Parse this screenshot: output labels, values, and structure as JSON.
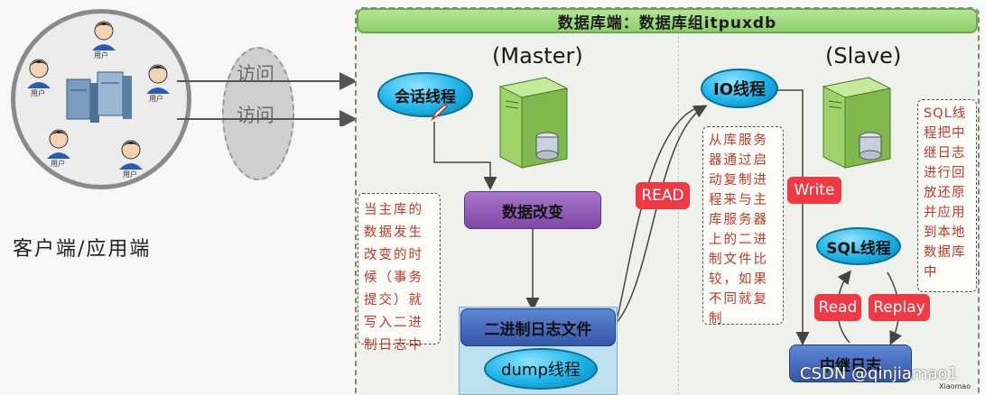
{
  "db_header": "数据库端：数据库组itpuxdb",
  "client_label": "客户端/应用端",
  "user_label": "用户",
  "access_labels": [
    "访问",
    "访问"
  ],
  "master_title": "(Master)",
  "slave_title": "(Slave)",
  "session_thread": "会话线程",
  "data_change": "数据改变",
  "binlog_file": "二进制日志文件",
  "dump_thread": "dump线程",
  "io_thread": "IO线程",
  "sql_thread": "SQL线程",
  "relay_log": "中继日志",
  "read_tag": "READ",
  "write_tag": "Write",
  "read_small_tag": "Read",
  "replay_tag": "Replay",
  "master_note": "当主库的数据发生改变的时候（事务提交）就写入二进制日志中",
  "io_note": "从库服务器通过启动复制进程来与主库服务器上的二进制文件比较，如果不同就复制",
  "sql_note": "SQL线程把中继日志进行回放还原并应用到本地数据库中",
  "watermark": "CSDN @qinjiamao1",
  "watermark_small": "Xiaomao",
  "colors": {
    "header_green": "#8fcf6a",
    "purple": "#8e56b3",
    "blue_box": "#3e64b5",
    "red_tag": "#ef3a45"
  }
}
